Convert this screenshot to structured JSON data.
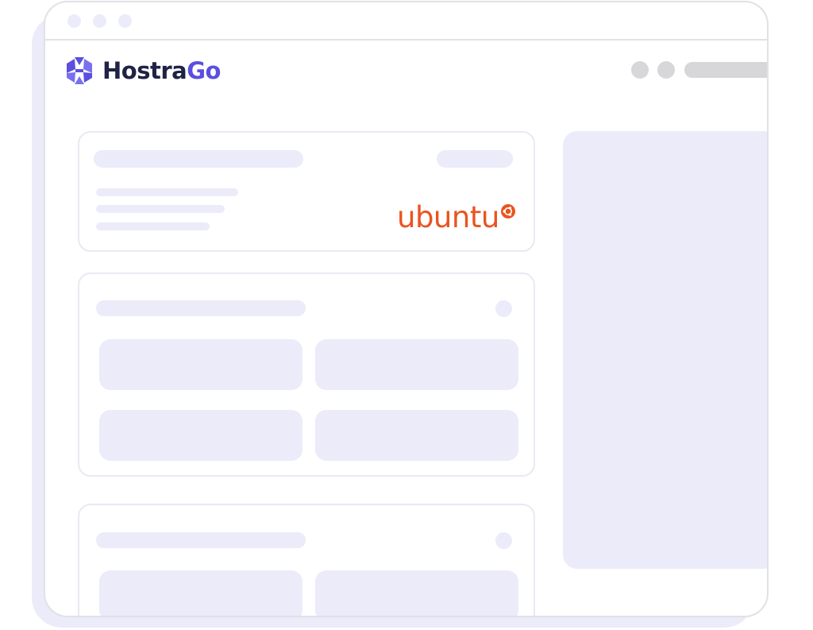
{
  "brand": {
    "name_part1": "Hostra",
    "name_part2": "Go"
  },
  "server_card": {
    "os_logo_text": "ubuntu"
  },
  "colors": {
    "brand_dark": "#1f2345",
    "brand_accent": "#5b4fe0",
    "ubuntu_orange": "#e95420",
    "skeleton": "#ebebfa",
    "window_border": "#e1e1e6",
    "shadow": "#ebebfa"
  },
  "icons": {
    "brand_logo": "hostrago-logo-icon",
    "os_logo": "ubuntu-circle-of-friends-icon"
  }
}
